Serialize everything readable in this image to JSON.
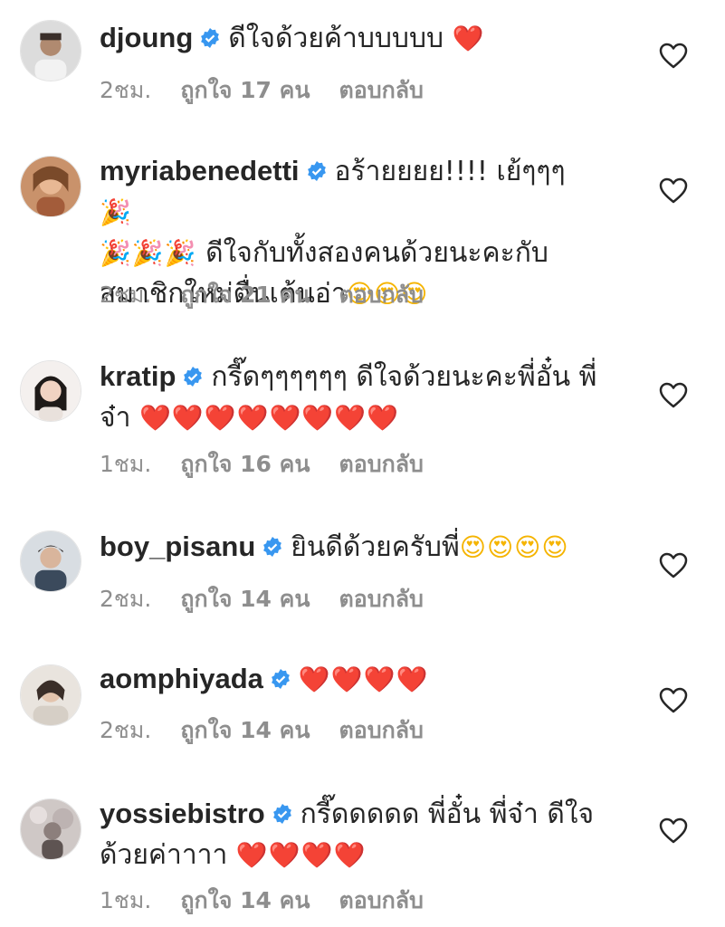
{
  "colors": {
    "text": "#262626",
    "meta": "#8e8e8e",
    "verified": "#3897f0",
    "heart": "#e0202c"
  },
  "comments": [
    {
      "username": "djoung",
      "verified": true,
      "line1": "ดีใจด้วยค้าบบบบบ",
      "line1_emoji": "❤️",
      "time": "2ชม.",
      "likes": "ถูกใจ 17 คน",
      "reply": "ตอบกลับ",
      "like_icon": "heart-outline-icon"
    },
    {
      "username": "myriabenedetti",
      "verified": true,
      "line1": "อร้ายยยย!!!! เย้ๆๆๆ",
      "line1_emoji": "🎉",
      "line2_emoji": "🎉🎉🎉",
      "line2": " ดีใจกับทั้งสองคนด้วยนะคะกับ",
      "line3": "สมาชิกใหม่ตื่นเต้นอ่า",
      "line3_emoji": "😍😍😍",
      "time": "2ชม.",
      "likes": "ถูกใจ 21 คน",
      "reply": "ตอบกลับ",
      "like_icon": "heart-outline-icon"
    },
    {
      "username": "kratip",
      "verified": true,
      "line1": "กรี๊ดๆๆๆๆๆๆ ดีใจด้วยนะคะพี่อั๋น พี่",
      "line2": "จ๋า",
      "line2_emoji": "❤️❤️❤️❤️❤️❤️❤️❤️",
      "time": "1ชม.",
      "likes": "ถูกใจ 16 คน",
      "reply": "ตอบกลับ",
      "like_icon": "heart-outline-icon"
    },
    {
      "username": "boy_pisanu",
      "verified": true,
      "line1": "ยินดีด้วยครับพี่",
      "line1_emoji": "😍😍😍😍",
      "time": "2ชม.",
      "likes": "ถูกใจ 14 คน",
      "reply": "ตอบกลับ",
      "like_icon": "heart-outline-icon"
    },
    {
      "username": "aomphiyada",
      "verified": true,
      "line1": "",
      "line1_emoji": "❤️❤️❤️❤️",
      "time": "2ชม.",
      "likes": "ถูกใจ 14 คน",
      "reply": "ตอบกลับ",
      "like_icon": "heart-outline-icon"
    },
    {
      "username": "yossiebistro",
      "verified": true,
      "line1": "กรี๊ดดดดด พี่อั๋น พี่จ๋า ดีใจ",
      "line2": "ด้วยค่าาาา",
      "line2_emoji": "❤️❤️❤️❤️",
      "time": "1ชม.",
      "likes": "ถูกใจ 14 คน",
      "reply": "ตอบกลับ",
      "like_icon": "heart-outline-icon"
    }
  ]
}
